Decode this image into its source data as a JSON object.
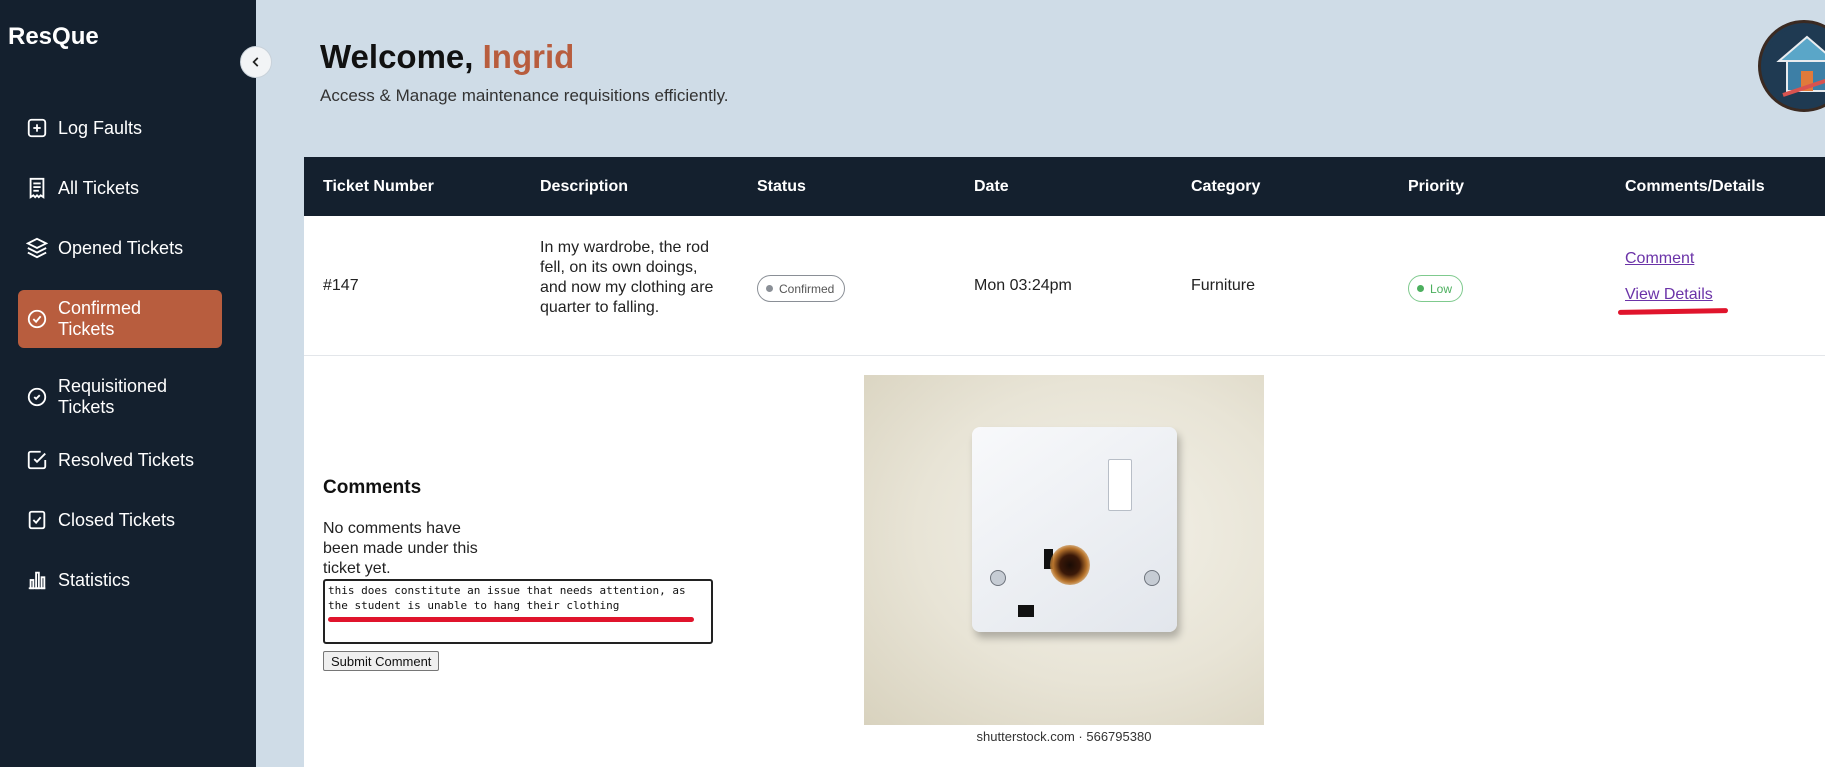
{
  "brand": "ResQue",
  "sidebar": {
    "items": [
      {
        "label": "Log Faults",
        "icon": "plus-square-icon"
      },
      {
        "label": "All Tickets",
        "icon": "receipt-icon"
      },
      {
        "label": "Opened Tickets",
        "icon": "layers-icon"
      },
      {
        "label": "Confirmed Tickets",
        "icon": "check-circle-icon",
        "active": true
      },
      {
        "label": "Requisitioned Tickets",
        "icon": "check-circle-outline-icon"
      },
      {
        "label": "Resolved Tickets",
        "icon": "check-square-icon"
      },
      {
        "label": "Closed Tickets",
        "icon": "clipboard-check-icon"
      },
      {
        "label": "Statistics",
        "icon": "bar-chart-icon"
      }
    ]
  },
  "header": {
    "welcome": "Welcome,",
    "user_name": "Ingrid",
    "subtitle": "Access & Manage maintenance requisitions efficiently."
  },
  "table": {
    "columns": [
      "Ticket Number",
      "Description",
      "Status",
      "Date",
      "Category",
      "Priority",
      "Comments/Details"
    ],
    "row": {
      "ticket_number": "#147",
      "description": "In my wardrobe, the rod fell, on its own doings, and now my clothing are quarter to falling.",
      "status": "Confirmed",
      "date": "Mon 03:24pm",
      "category": "Furniture",
      "priority": "Low",
      "comment_link": "Comment",
      "details_link": "View Details"
    }
  },
  "comments": {
    "title": "Comments",
    "empty_text": "No comments have been made under this ticket yet.",
    "input_value": "this does constitute an issue that needs attention, as the student is unable to hang their clothing",
    "submit_label": "Submit Comment"
  },
  "photo": {
    "watermark": "shutterstock.com · 566795380"
  },
  "colors": {
    "sidebar_bg": "#14202e",
    "accent": "#b85d3e",
    "page_bg": "#cfdce7",
    "low_priority": "#4caf5e",
    "annotation_red": "#e0142c"
  }
}
